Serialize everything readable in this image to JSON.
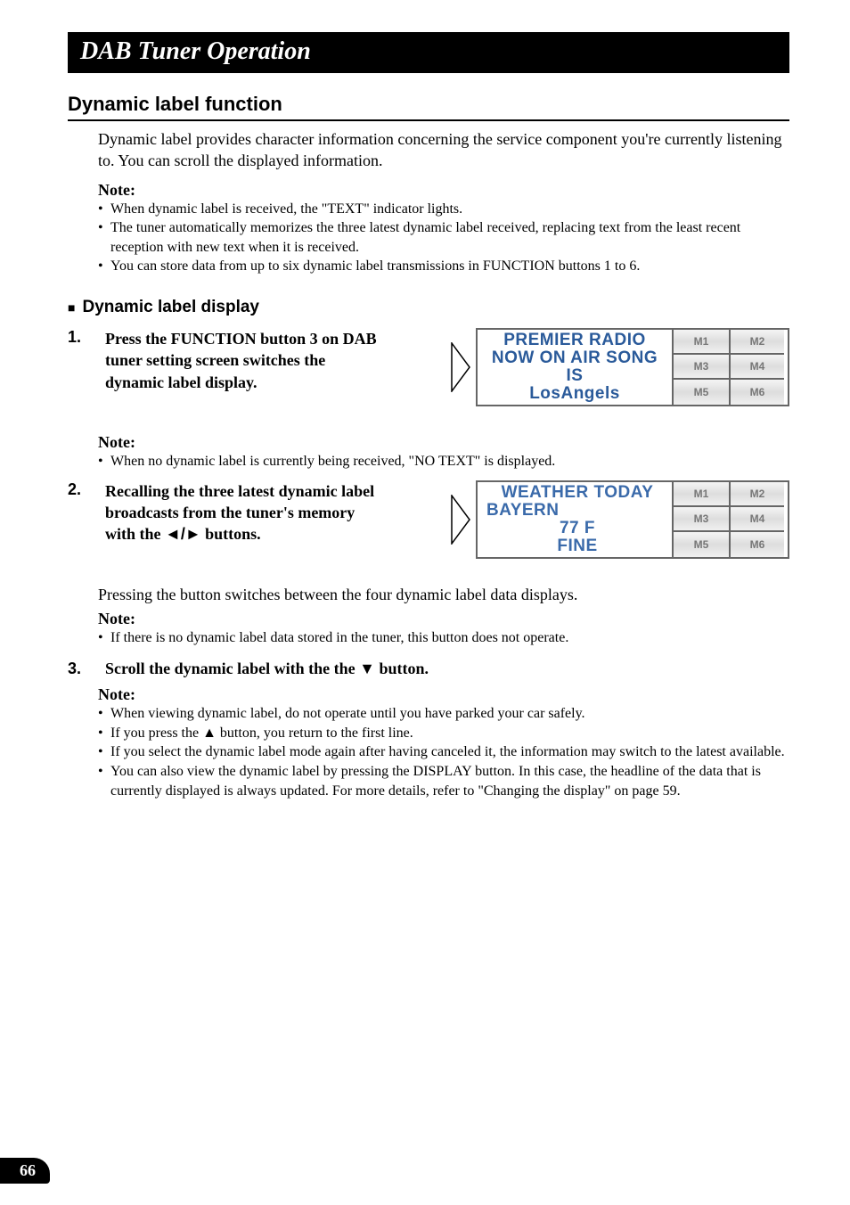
{
  "title_bar": "DAB Tuner Operation",
  "section_heading": "Dynamic label function",
  "intro": "Dynamic label provides character information concerning the service component you're currently listening to. You can scroll the displayed information.",
  "note_label": "Note:",
  "notes_top": [
    "When dynamic label is received, the \"TEXT\" indicator lights.",
    "The tuner automatically memorizes the three latest dynamic label received, replacing text from the least recent reception with new text when it is received.",
    "You can store data from up to six dynamic label transmissions in FUNCTION buttons 1 to 6."
  ],
  "sub_heading": "Dynamic label display",
  "step1": {
    "num": "1.",
    "text": "Press the FUNCTION button 3 on DAB tuner setting screen switches the dynamic label display."
  },
  "screen1": {
    "l1": "PREMIER RADIO",
    "l2": "NOW ON AIR SONG",
    "l3": "IS",
    "l4": "LosAngels",
    "mem": [
      "M1",
      "M2",
      "M3",
      "M4",
      "M5",
      "M6"
    ]
  },
  "note2": {
    "label": "Note:",
    "items": [
      "When no dynamic label is currently being received, \"NO TEXT\" is displayed."
    ]
  },
  "step2": {
    "num": "2.",
    "text_pre": "Recalling the three latest dynamic label broadcasts from the tuner's memory with the ",
    "text_post": " buttons.",
    "arrows": "◄/►"
  },
  "screen2": {
    "l1": "WEATHER TODAY",
    "l2": "BAYERN",
    "l3": "77 F",
    "l4": "FINE",
    "mem": [
      "M1",
      "M2",
      "M3",
      "M4",
      "M5",
      "M6"
    ]
  },
  "after_step2_para": "Pressing the button switches between the four dynamic label data displays.",
  "note3": {
    "label": "Note:",
    "items": [
      "If there is no dynamic label data stored in the tuner, this button does not operate."
    ]
  },
  "step3": {
    "num": "3.",
    "text_pre": "Scroll the dynamic label with the the ",
    "arrow": "▼",
    "text_post": " button."
  },
  "note4": {
    "label": "Note:",
    "up_arrow": "▲",
    "items": [
      "When viewing dynamic label, do not operate until you have parked your car safely.",
      "If you press the ▲ button, you return to the first line.",
      "If you select the dynamic label mode again after having canceled it, the information may switch to the latest available.",
      "You can also view the dynamic label by pressing the DISPLAY button. In this case, the headline of the data that is currently displayed is always updated. For more details, refer to \"Changing the display\" on page 59."
    ]
  },
  "page_number": "66"
}
